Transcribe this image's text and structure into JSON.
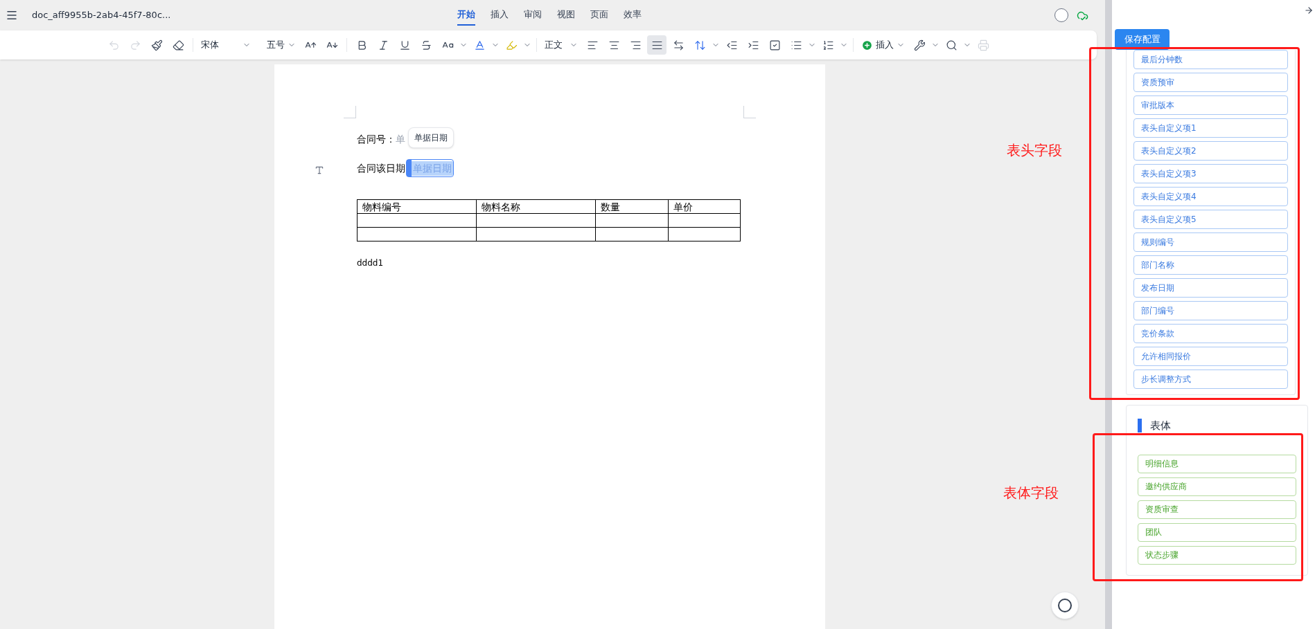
{
  "title_bar": {
    "doc_name": "doc_aff9955b-2ab4-45f7-80c...",
    "tabs": [
      {
        "label": "开始",
        "selected": true
      },
      {
        "label": "插入",
        "selected": false
      },
      {
        "label": "审阅",
        "selected": false
      },
      {
        "label": "视图",
        "selected": false
      },
      {
        "label": "页面",
        "selected": false
      },
      {
        "label": "效率",
        "selected": false
      }
    ]
  },
  "toolbar": {
    "undo": {
      "disabled": true
    },
    "redo": {
      "disabled": true
    },
    "font": "宋体",
    "size": "五号",
    "style": "正文",
    "align_buttons": [
      {
        "selected": false
      },
      {
        "selected": false
      },
      {
        "selected": false
      },
      {
        "selected": true
      }
    ],
    "insert": "插入",
    "print": {
      "disabled": true
    }
  },
  "document": {
    "line_1": {
      "label": "合同号：",
      "field_value": "单",
      "tooltip": "单据日期"
    },
    "line_2": {
      "label": "合同该日期",
      "field_value": "单据日期",
      "selected": true
    },
    "table": {
      "columns": [
        "物料编号",
        "物料名称",
        "数量",
        "单价"
      ],
      "rows": [
        [
          "",
          "",
          "",
          ""
        ],
        [
          "",
          "",
          "",
          ""
        ]
      ]
    },
    "paragraph": "dddd1"
  },
  "panel": {
    "save_button": "保存配置",
    "header_fields": [
      "最后分钟数",
      "资质预审",
      "审批版本",
      "表头自定义项1",
      "表头自定义项2",
      "表头自定义项3",
      "表头自定义项4",
      "表头自定义项5",
      "规则编号",
      "部门名称",
      "发布日期",
      "部门编号",
      "竞价条款",
      "允许相同报价",
      "步长调整方式"
    ],
    "body_section": {
      "title": "表体",
      "fields": [
        "明细信息",
        "邀约供应商",
        "资质审查",
        "团队",
        "状态步骤"
      ]
    }
  },
  "annotations": [
    {
      "label": "表头字段"
    },
    {
      "label": "表体字段"
    }
  ]
}
